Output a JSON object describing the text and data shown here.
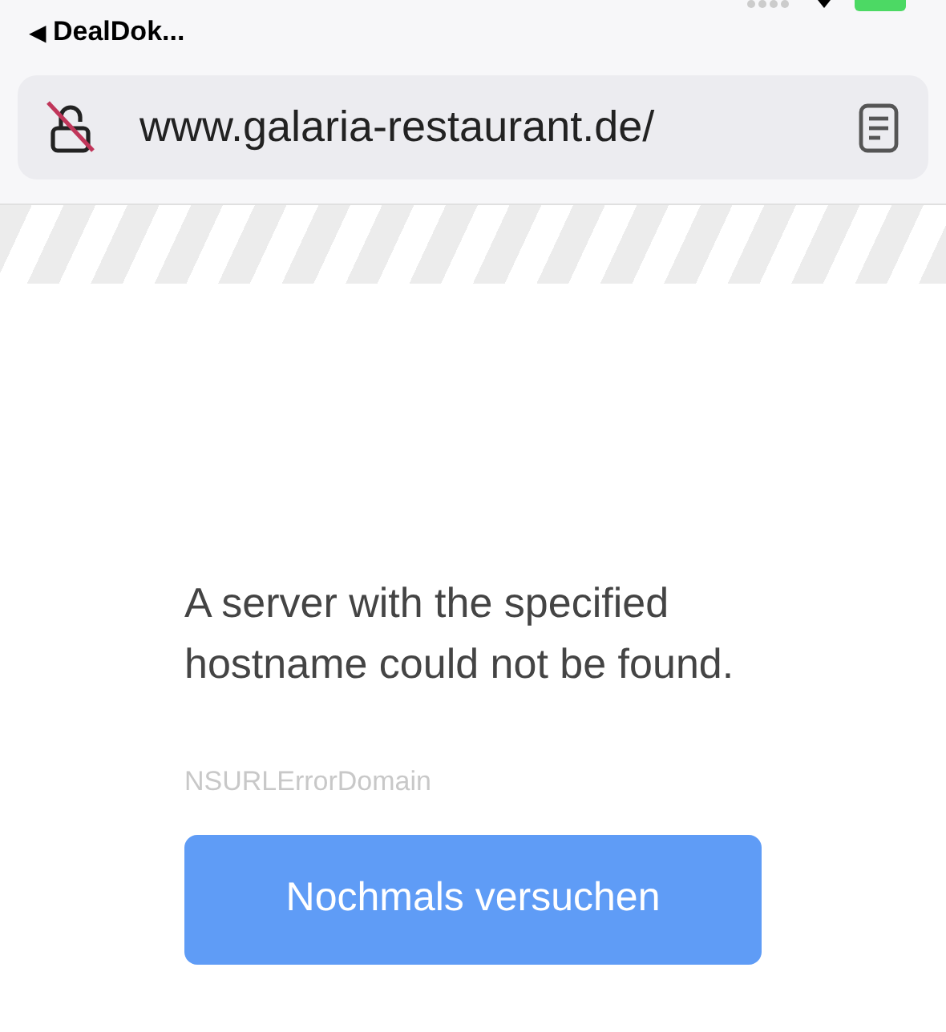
{
  "status_bar": {
    "back_arrow": "◀",
    "back_label": "DealDok..."
  },
  "address_bar": {
    "url": "www.galaria-restaurant.de/"
  },
  "error": {
    "message": "A server with the specified hostname could not be found.",
    "domain": "NSURLErrorDomain",
    "button": "Nochmals versuchen"
  }
}
